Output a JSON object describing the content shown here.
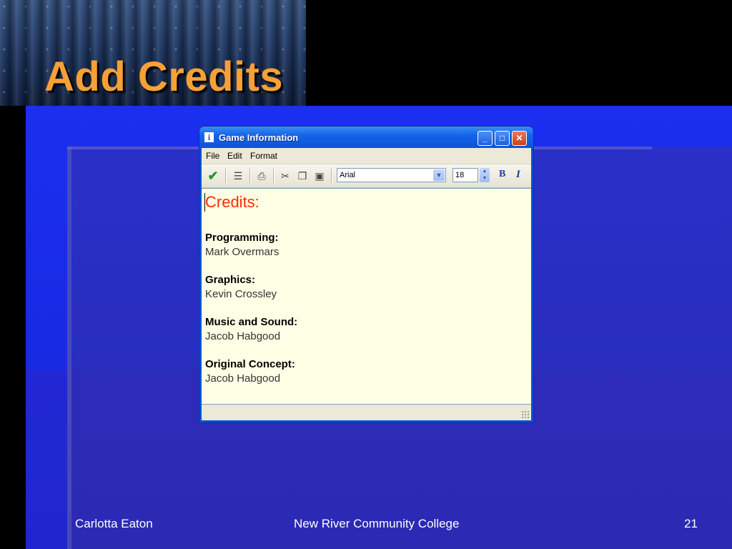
{
  "slide": {
    "title": "Add Credits",
    "footer_left": "Carlotta Eaton",
    "footer_center": "New River Community College",
    "footer_right": "21"
  },
  "window": {
    "title": "Game Information",
    "icon": "info-icon",
    "controls": {
      "minimize": "minimize-icon",
      "maximize": "maximize-icon",
      "close": "close-icon"
    }
  },
  "menu": {
    "file": "File",
    "edit": "Edit",
    "format": "Format"
  },
  "toolbar": {
    "font_name": "Arial",
    "font_size": "18",
    "bold_label": "B",
    "italic_label": "I"
  },
  "document": {
    "heading": "Credits:",
    "sections": [
      {
        "label": "Programming:",
        "value": "Mark Overmars"
      },
      {
        "label": "Graphics:",
        "value": "Kevin Crossley"
      },
      {
        "label": "Music and Sound:",
        "value": "Jacob Habgood"
      },
      {
        "label": "Original Concept:",
        "value": "Jacob Habgood"
      }
    ]
  },
  "colors": {
    "title": "#f7a035",
    "heading": "#ff2a00",
    "editor_bg": "#ffffe6",
    "slide_blue": "#1b2ff0"
  }
}
